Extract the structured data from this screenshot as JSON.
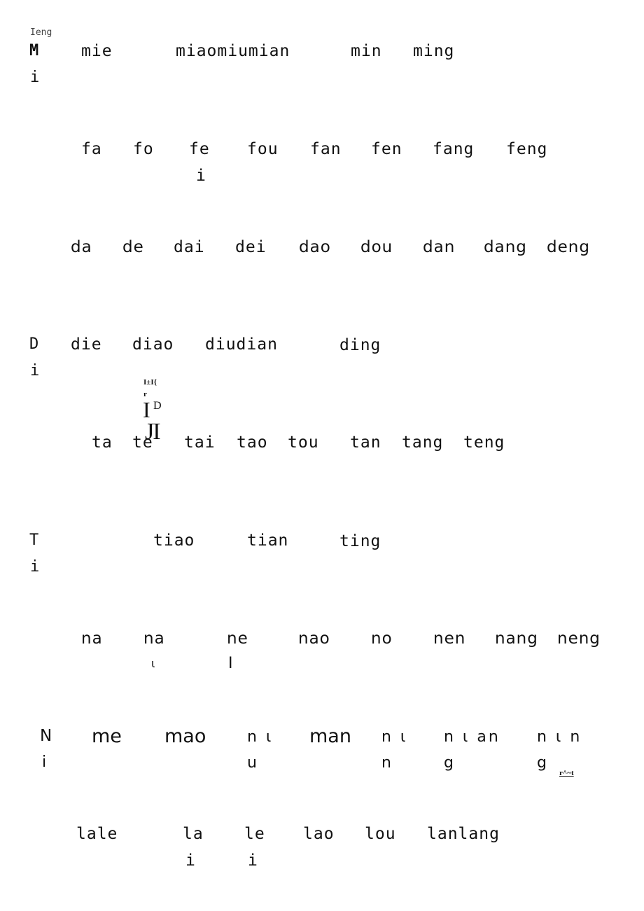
{
  "header_label": "Ieng",
  "rows": {
    "m_row": {
      "initial_top": "M",
      "initial_bottom": "i",
      "syllables": [
        "mie",
        "miaomiumian",
        "min",
        "ming"
      ]
    },
    "f_row": {
      "syllables": [
        "fa",
        "fo",
        "fe",
        "fou",
        "fan",
        "fen",
        "fang",
        "feng"
      ],
      "fe_sub": "i"
    },
    "d_row": {
      "syllables": [
        "da",
        "de",
        "dai",
        "dei",
        "dao",
        "dou",
        "dan",
        "dang",
        "deng"
      ]
    },
    "di_row": {
      "initial_top": "D",
      "initial_bottom": "i",
      "syllables": [
        "die",
        "diao",
        "diudian",
        "ding"
      ]
    },
    "artifact": {
      "line1": "I±I{",
      "line2": "r",
      "line3_big": "I",
      "line3_sup": "D",
      "line4": "JI"
    },
    "t_row": {
      "syllables": [
        "ta",
        "te",
        "tai",
        "tao",
        "tou",
        "tan",
        "tang",
        "teng"
      ]
    },
    "ti_row": {
      "initial_top": "T",
      "initial_bottom": "i",
      "syllables": [
        "tiao",
        "tian",
        "ting"
      ]
    },
    "n_row": {
      "syllables": [
        "na",
        "na",
        "ne",
        "nao",
        "no",
        "nen",
        "nang",
        "neng"
      ],
      "na2_sub": "ι",
      "ne_sub": "I"
    },
    "ni_row": {
      "initial_top": "N",
      "initial_bottom": "i",
      "syllables": [
        "me",
        "mao",
        "man"
      ],
      "niu_top": "n ι",
      "niu_bottom": "u",
      "nin_top": "n ι",
      "nin_bottom": "n",
      "nian_top": "n ι an",
      "nian_bottom": "g",
      "ning_top": "n ι n",
      "ning_bottom": "g",
      "footnote_mark": "r^~t"
    },
    "l_row": {
      "syllables": [
        "lale",
        "la",
        "le",
        "lao",
        "lou",
        "lanlang"
      ],
      "la_sub": "i",
      "le_sub": "i"
    }
  }
}
